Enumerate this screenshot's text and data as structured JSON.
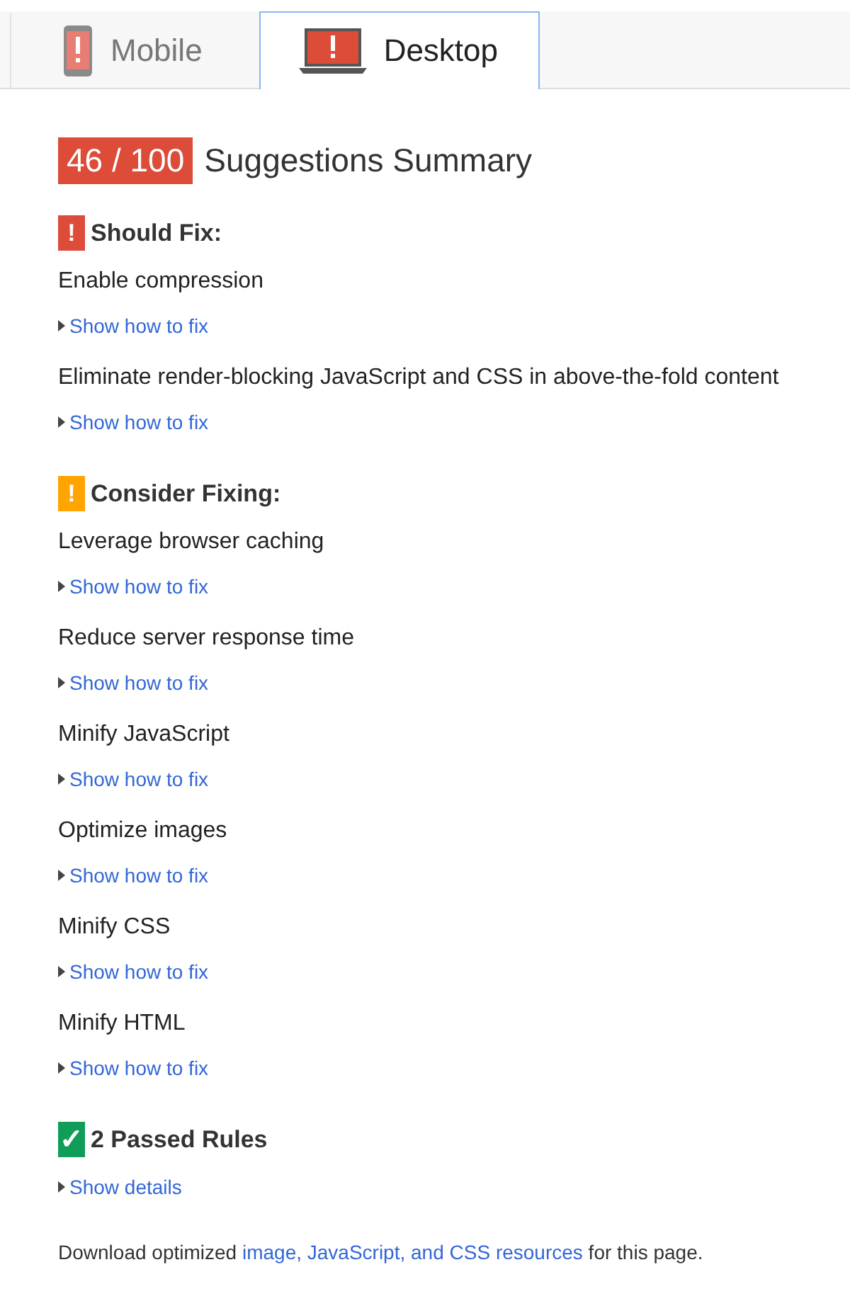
{
  "tabs": [
    {
      "label": "Mobile",
      "kind": "phone",
      "selected": false
    },
    {
      "label": "Desktop",
      "kind": "laptop",
      "selected": true
    }
  ],
  "summary": {
    "score": "46 / 100",
    "title": "Suggestions Summary"
  },
  "sections": [
    {
      "kind": "should_fix",
      "icon": "!",
      "title": "Should Fix:",
      "items": [
        {
          "title": "Enable compression",
          "link": "Show how to fix"
        },
        {
          "title": "Eliminate render-blocking JavaScript and CSS in above-the-fold content",
          "link": "Show how to fix"
        }
      ]
    },
    {
      "kind": "consider",
      "icon": "!",
      "title": "Consider Fixing:",
      "items": [
        {
          "title": "Leverage browser caching",
          "link": "Show how to fix"
        },
        {
          "title": "Reduce server response time",
          "link": "Show how to fix"
        },
        {
          "title": "Minify JavaScript",
          "link": "Show how to fix"
        },
        {
          "title": "Optimize images",
          "link": "Show how to fix"
        },
        {
          "title": "Minify CSS",
          "link": "Show how to fix"
        },
        {
          "title": "Minify HTML",
          "link": "Show how to fix"
        }
      ]
    },
    {
      "kind": "passed",
      "icon": "✓",
      "title": "2 Passed Rules",
      "items": [
        {
          "link": "Show details"
        }
      ]
    }
  ],
  "footer": {
    "before": "Download optimized ",
    "link": "image, JavaScript, and CSS resources",
    "after": " for this page."
  }
}
